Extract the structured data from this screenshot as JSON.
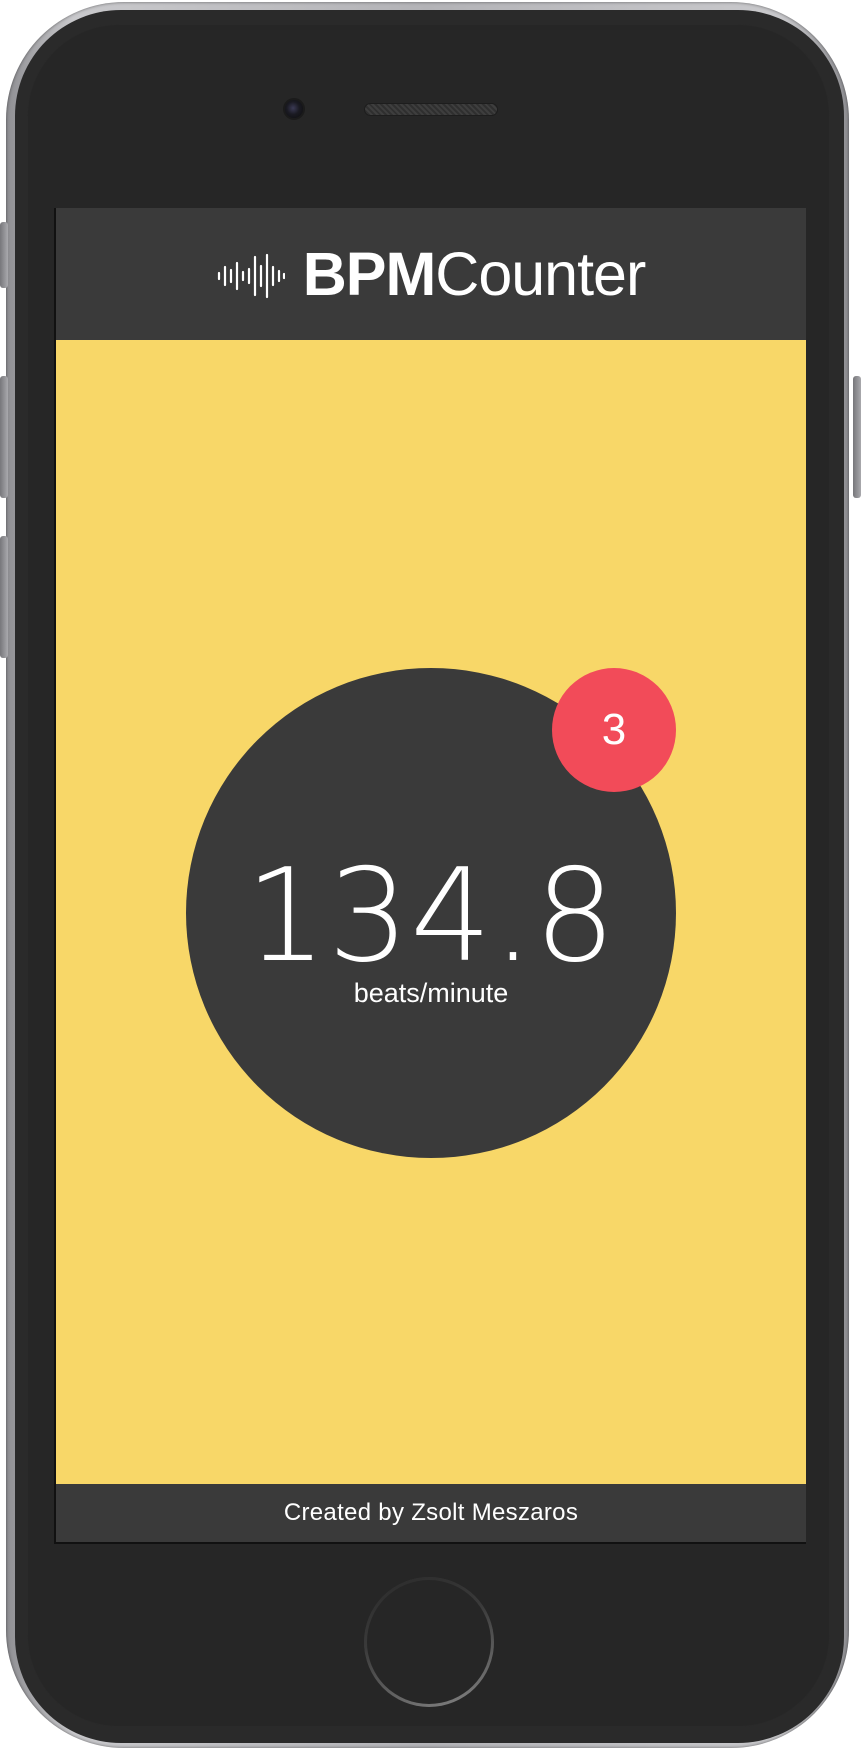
{
  "app": {
    "title_bold": "BPM",
    "title_light": "Counter",
    "logo_icon": "audio-waveform-icon"
  },
  "counter": {
    "bpm_value": "134.8",
    "unit_label": "beats/minute",
    "tap_count": "3"
  },
  "footer": {
    "credit": "Created by Zsolt Meszaros"
  },
  "colors": {
    "background": "#f8d768",
    "header_footer": "#3a3a3a",
    "circle": "#3a3a3a",
    "badge": "#f24b59",
    "text": "#ffffff"
  }
}
